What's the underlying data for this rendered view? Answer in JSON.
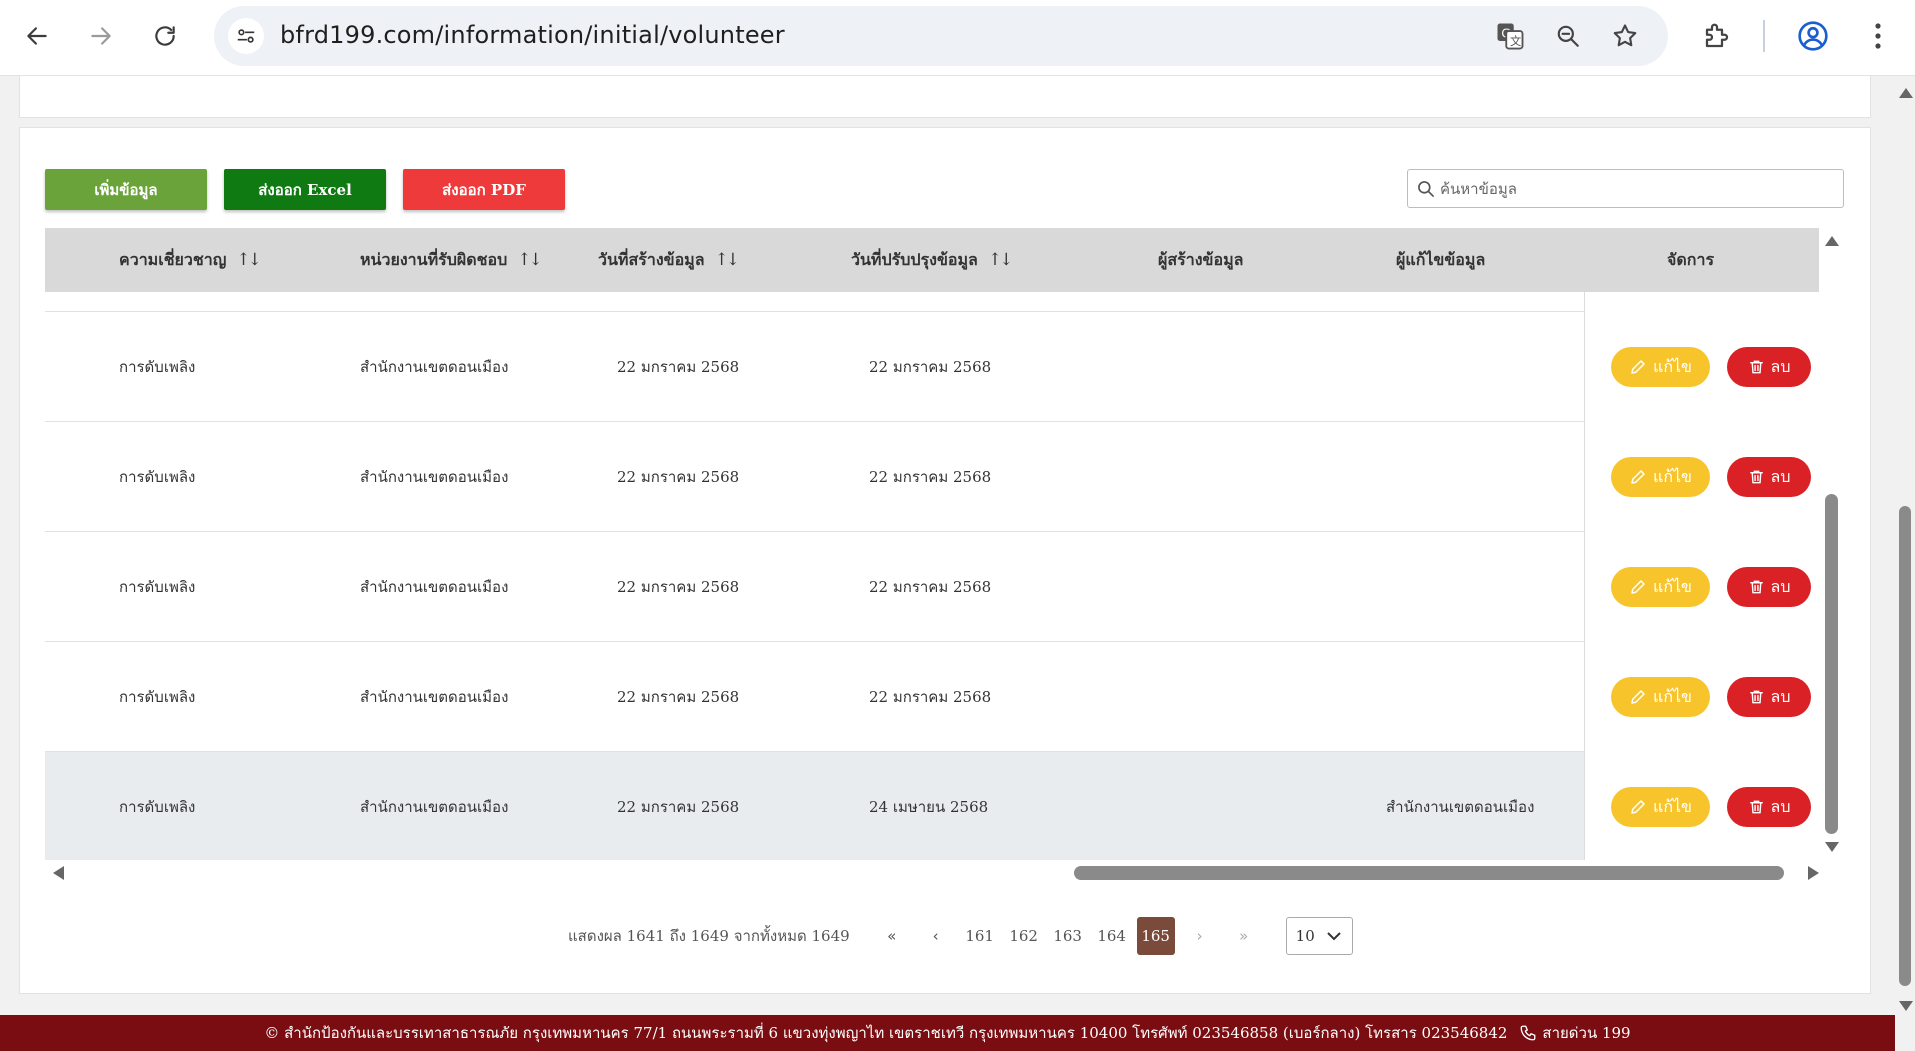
{
  "browser": {
    "url": "bfrd199.com/information/initial/volunteer",
    "icons": [
      "back-icon",
      "forward-icon",
      "reload-icon",
      "site-info-icon",
      "translate-icon",
      "zoom-icon",
      "bookmark-star-icon",
      "extensions-icon",
      "profile-icon",
      "menu-kebab-icon"
    ]
  },
  "toolbar": {
    "add_label": "เพิ่มข้อมูล",
    "excel_label": "ส่งออก Excel",
    "pdf_label": "ส่งออก PDF",
    "search_placeholder": "ค้นหาข้อมูล"
  },
  "table": {
    "columns": [
      {
        "label": "ความเชี่ยวชาญ",
        "sortable": true
      },
      {
        "label": "หน่วยงานที่รับผิดชอบ",
        "sortable": true
      },
      {
        "label": "วันที่สร้างข้อมูล",
        "sortable": true
      },
      {
        "label": "วันที่ปรับปรุงข้อมูล",
        "sortable": true
      },
      {
        "label": "ผู้สร้างข้อมูล",
        "sortable": false
      },
      {
        "label": "ผู้แก้ไขข้อมูล",
        "sortable": false
      },
      {
        "label": "จัดการ",
        "sortable": false
      }
    ],
    "sort_glyph": "↑↓",
    "edit_label": "แก้ไข",
    "delete_label": "ลบ",
    "rows": [
      {
        "expertise": "การดับเพลิง",
        "agency": "สำนักงานเขตดอนเมือง",
        "created": "22 มกราคม 2568",
        "updated": "22 มกราคม 2568",
        "creator": "",
        "editor": ""
      },
      {
        "expertise": "การดับเพลิง",
        "agency": "สำนักงานเขตดอนเมือง",
        "created": "22 มกราคม 2568",
        "updated": "22 มกราคม 2568",
        "creator": "",
        "editor": ""
      },
      {
        "expertise": "การดับเพลิง",
        "agency": "สำนักงานเขตดอนเมือง",
        "created": "22 มกราคม 2568",
        "updated": "22 มกราคม 2568",
        "creator": "",
        "editor": ""
      },
      {
        "expertise": "การดับเพลิง",
        "agency": "สำนักงานเขตดอนเมือง",
        "created": "22 มกราคม 2568",
        "updated": "22 มกราคม 2568",
        "creator": "",
        "editor": ""
      },
      {
        "expertise": "การดับเพลิง",
        "agency": "สำนักงานเขตดอนเมือง",
        "created": "22 มกราคม 2568",
        "updated": "24 เมษายน 2568",
        "creator": "",
        "editor": "สำนักงานเขตดอนเมือง",
        "highlighted": true
      }
    ]
  },
  "pagination": {
    "info": "แสดงผล 1641 ถึง 1649 จากทั้งหมด 1649",
    "first": "«",
    "prev": "‹",
    "pages": [
      "161",
      "162",
      "163",
      "164",
      "165"
    ],
    "active_page": "165",
    "next": "›",
    "last": "»",
    "page_size": "10"
  },
  "footer": {
    "text": "© สำนักป้องกันและบรรเทาสาธารณภัย กรุงเทพมหานคร 77/1 ถนนพระรามที่ 6 แขวงทุ่งพญาไท เขตราชเทวี กรุงเทพมหานคร 10400 โทรศัพท์ 023546858 (เบอร์กลาง) โทรสาร 023546842",
    "hotline": "สายด่วน 199"
  },
  "colors": {
    "add": "#6aa33a",
    "excel": "#0f7a12",
    "pdf": "#ee3a3a",
    "edit": "#f8c42b",
    "delete": "#d92126",
    "active_page": "#7a4a3a",
    "footer": "#7a0d11"
  }
}
